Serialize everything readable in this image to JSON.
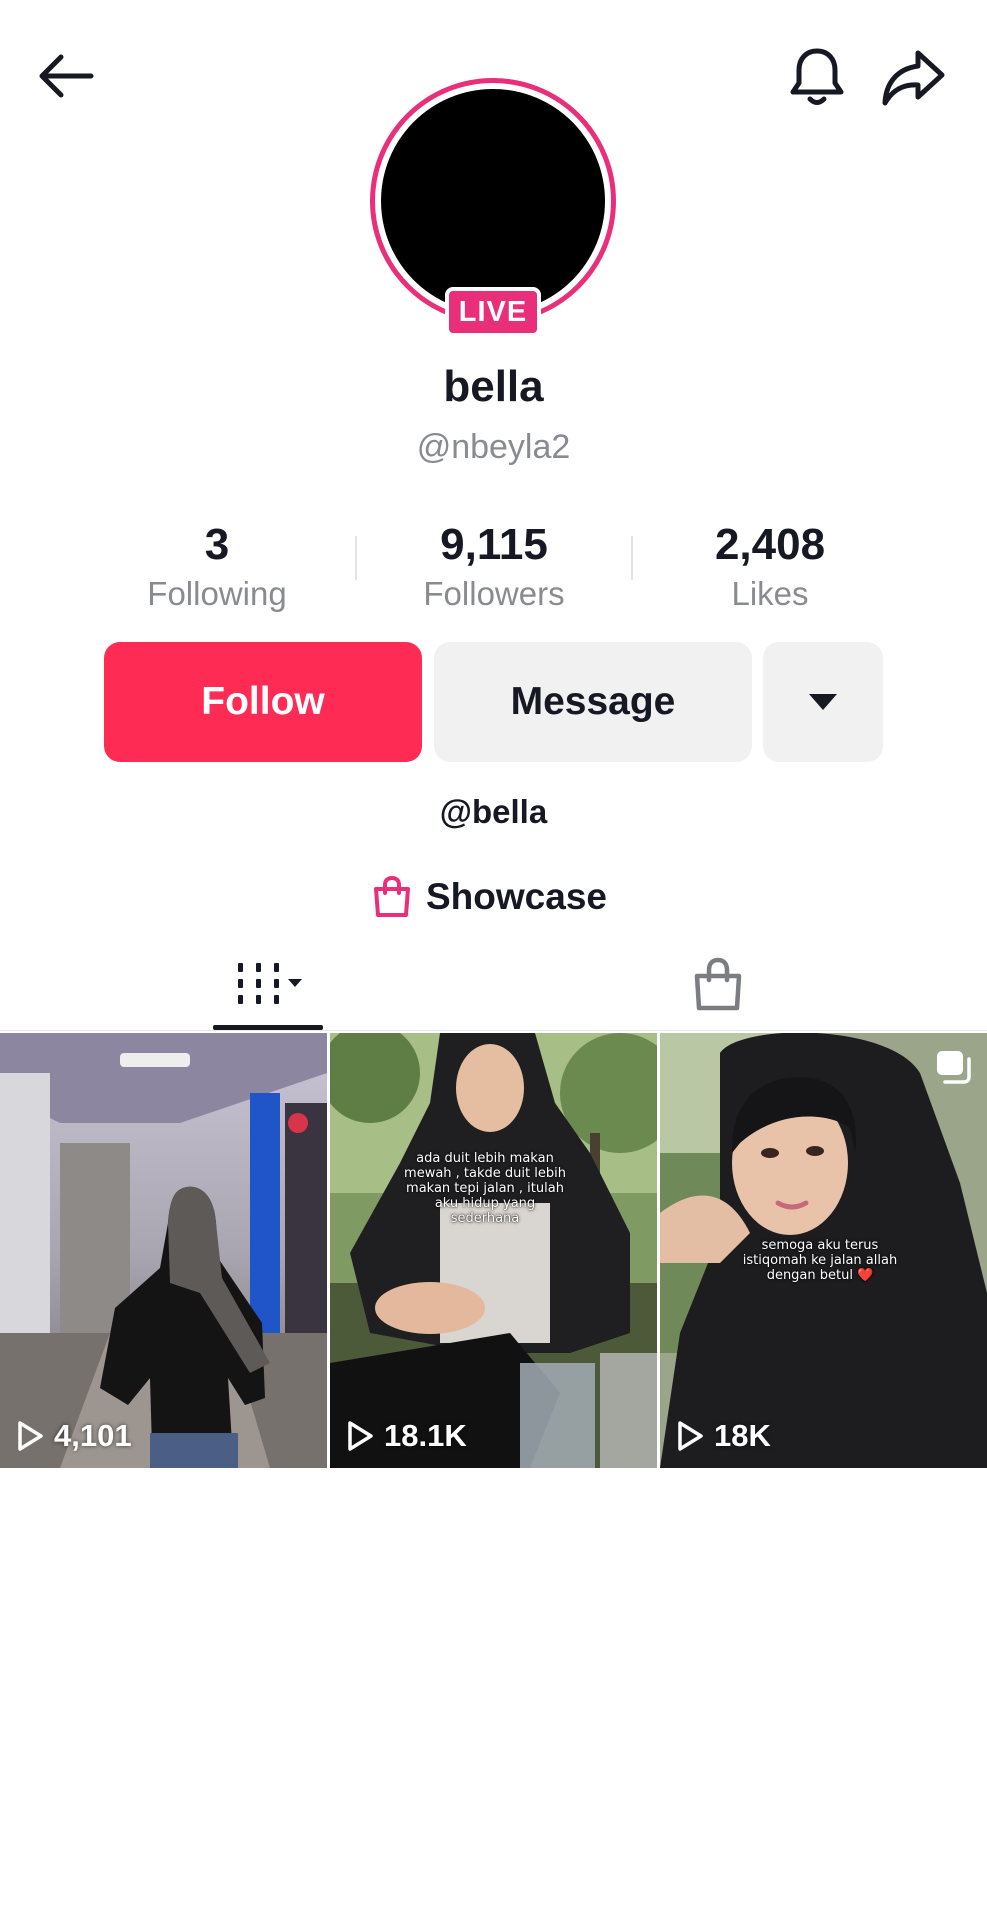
{
  "header": {
    "back_icon": "back-arrow-icon",
    "bell_icon": "bell-icon",
    "share_icon": "share-icon"
  },
  "profile": {
    "live_badge": "LIVE",
    "display_name": "bella",
    "username": "@nbeyla2",
    "bio": "@bella",
    "accent_color": "#ea2f7a"
  },
  "stats": [
    {
      "value": "3",
      "label": "Following"
    },
    {
      "value": "9,115",
      "label": "Followers"
    },
    {
      "value": "2,408",
      "label": "Likes"
    }
  ],
  "actions": {
    "follow_label": "Follow",
    "message_label": "Message",
    "more_icon": "caret-down-icon",
    "follow_color": "#fe2c55"
  },
  "showcase": {
    "label": "Showcase",
    "icon": "shopping-bag-icon"
  },
  "tabs": [
    {
      "icon": "video-grid-icon",
      "active": true
    },
    {
      "icon": "shopping-bag-icon",
      "active": false
    }
  ],
  "videos": [
    {
      "views": "4,101",
      "caption": "",
      "multi_image": false
    },
    {
      "views": "18.1K",
      "caption": "ada duit lebih makan mewah , takde duit lebih makan tepi jalan , itulah aku hidup yang sederhana",
      "multi_image": false
    },
    {
      "views": "18K",
      "caption": "semoga aku terus istiqomah ke jalan allah dengan betul ❤️",
      "multi_image": true
    }
  ]
}
